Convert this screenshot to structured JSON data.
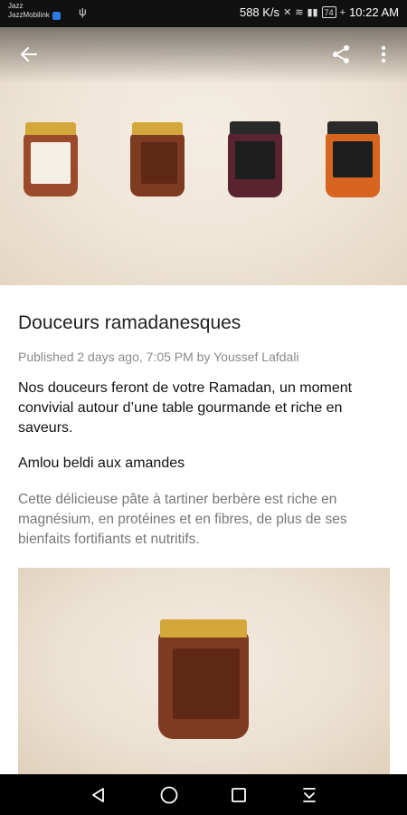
{
  "status_bar": {
    "carrier_line1": "Jazz",
    "carrier_line2": "JazzMobilink",
    "net_speed": "588 K/s",
    "battery": "74",
    "time": "10:22 AM"
  },
  "toolbar": {
    "back_icon": "arrow-left-icon",
    "share_icon": "share-icon",
    "more_icon": "more-vert-icon"
  },
  "hero": {
    "jars": [
      {
        "name": "amlou-amandes-jar",
        "lid": "#d4a73a",
        "body": "#9c4a2c",
        "label": "#f4efe6"
      },
      {
        "name": "amlou-chocolat-jar",
        "lid": "#d4a73a",
        "body": "#7d3b22",
        "label": "#6b2e1a"
      },
      {
        "name": "jam-fig-jar",
        "lid": "#2a2a2a",
        "body": "#5a2330",
        "label": "#1e1e1e"
      },
      {
        "name": "jam-orange-jar",
        "lid": "#2a2a2a",
        "body": "#d7641f",
        "label": "#1e1e1e"
      }
    ]
  },
  "article": {
    "title": "Douceurs ramadanesques",
    "meta": "Published 2 days ago, 7:05 PM by Youssef Lafdali",
    "intro": "Nos douceurs feront de votre Ramadan, un moment convivial autour d’une table gourmande et riche en saveurs.",
    "subhead": "Amlou beldi aux amandes",
    "description": "Cette délicieuse pâte à tartiner berbère est riche en magnésium, en protéines et en fibres, de plus de ses bienfaits fortifiants et nutritifs."
  },
  "nav_bar": {
    "back": "nav-back-icon",
    "home": "nav-home-icon",
    "recents": "nav-recents-icon",
    "notifications": "nav-notification-icon"
  }
}
